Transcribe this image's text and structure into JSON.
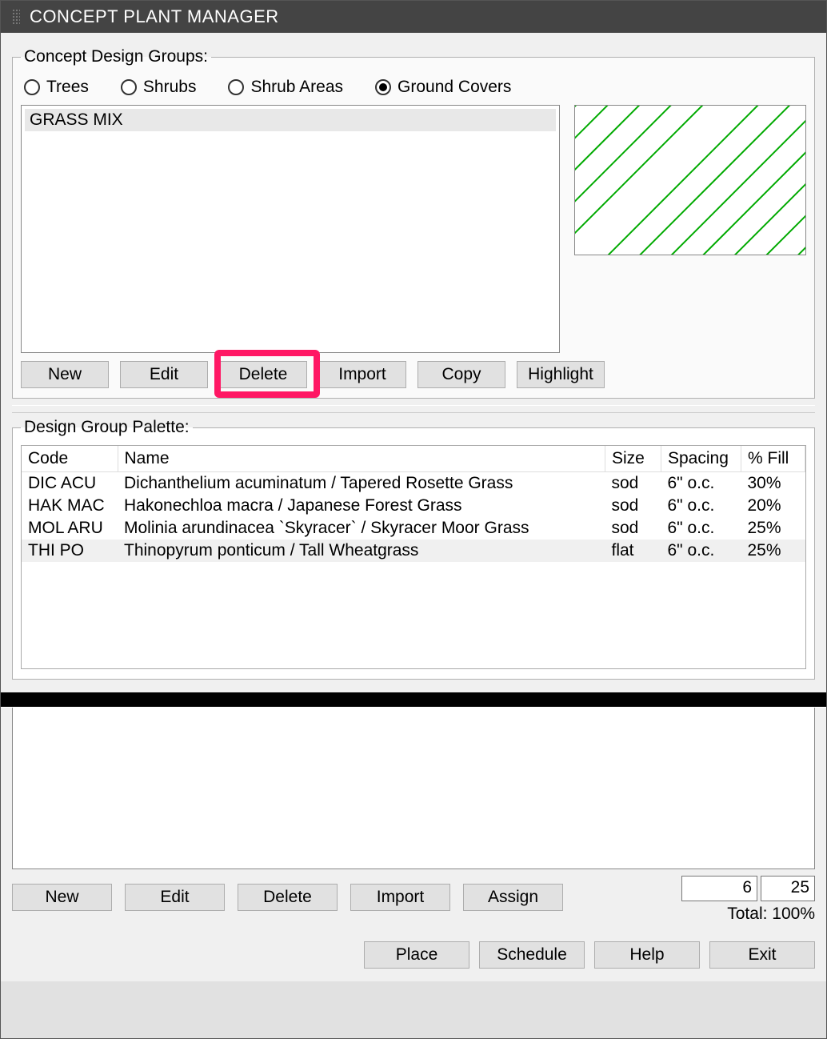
{
  "title": "CONCEPT PLANT MANAGER",
  "groups": {
    "legend": "Concept Design Groups:",
    "radios": {
      "trees": "Trees",
      "shrubs": "Shrubs",
      "shrub_areas": "Shrub Areas",
      "ground_covers": "Ground Covers",
      "selected": "ground_covers"
    },
    "list": {
      "item0": "GRASS MIX"
    },
    "buttons": {
      "new": "New",
      "edit": "Edit",
      "delete": "Delete",
      "import": "Import",
      "copy": "Copy",
      "highlight": "Highlight"
    }
  },
  "palette": {
    "legend": "Design Group Palette:",
    "headers": {
      "code": "Code",
      "name": "Name",
      "size": "Size",
      "spacing": "Spacing",
      "fill": "% Fill"
    },
    "rows": [
      {
        "code": "DIC ACU",
        "name": "Dichanthelium acuminatum / Tapered Rosette Grass",
        "size": "sod",
        "spacing": "6\" o.c.",
        "fill": "30%"
      },
      {
        "code": "HAK MAC",
        "name": "Hakonechloa macra / Japanese Forest Grass",
        "size": "sod",
        "spacing": "6\" o.c.",
        "fill": "20%"
      },
      {
        "code": "MOL ARU",
        "name": "Molinia arundinacea `Skyracer` / Skyracer Moor Grass",
        "size": "sod",
        "spacing": "6\" o.c.",
        "fill": "25%"
      },
      {
        "code": "THI  PO",
        "name": "Thinopyrum  ponticum / Tall Wheatgrass",
        "size": "flat",
        "spacing": "6\" o.c.",
        "fill": "25%"
      }
    ],
    "buttons": {
      "new": "New",
      "edit": "Edit",
      "delete": "Delete",
      "import": "Import",
      "assign": "Assign"
    },
    "spacing_value": "6",
    "fill_value": "25",
    "total_label": "Total: 100%"
  },
  "footer": {
    "place": "Place",
    "schedule": "Schedule",
    "help": "Help",
    "exit": "Exit"
  }
}
